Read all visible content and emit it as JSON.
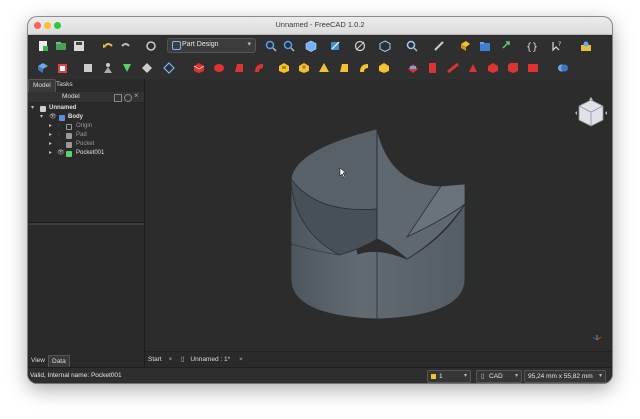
{
  "window": {
    "title": "Unnamed - FreeCAD 1.0.2"
  },
  "toolbar": {
    "workbench": "Part Design"
  },
  "panel": {
    "tabs": [
      "Model",
      "Tasks"
    ],
    "header": "Model",
    "tree": [
      "Unnamed",
      "Body",
      "Origin",
      "Pad",
      "Pocket",
      "Pocket001"
    ],
    "bottom_tabs": [
      "View",
      "Data"
    ]
  },
  "doc_tabs": {
    "start": "Start",
    "doc": "Unnamed : 1*"
  },
  "status": {
    "message": "Valid, Internal name: Pocket001",
    "layer": "1",
    "nav_style": "CAD",
    "dimensions": "95,24 mm x 55,82 mm"
  },
  "colors": {
    "viewport": "#2c2c2c",
    "part": "#5b636b",
    "chrome": "#2f2f2f"
  },
  "icons": [
    "new-file-icon",
    "open-icon",
    "save-icon",
    "undo-icon",
    "redo-icon",
    "refresh-icon",
    "fit-all-icon",
    "fit-selection-icon",
    "view-cube-icon",
    "std-view-icon",
    "draw-style-icon",
    "bounding-box-icon",
    "zoom-icon",
    "measure-icon",
    "part-icon",
    "group-icon",
    "link-icon",
    "macro-icon",
    "what-is-icon",
    "body-icon",
    "sketch-icon",
    "pad-icon",
    "pocket-icon",
    "hole-icon"
  ]
}
